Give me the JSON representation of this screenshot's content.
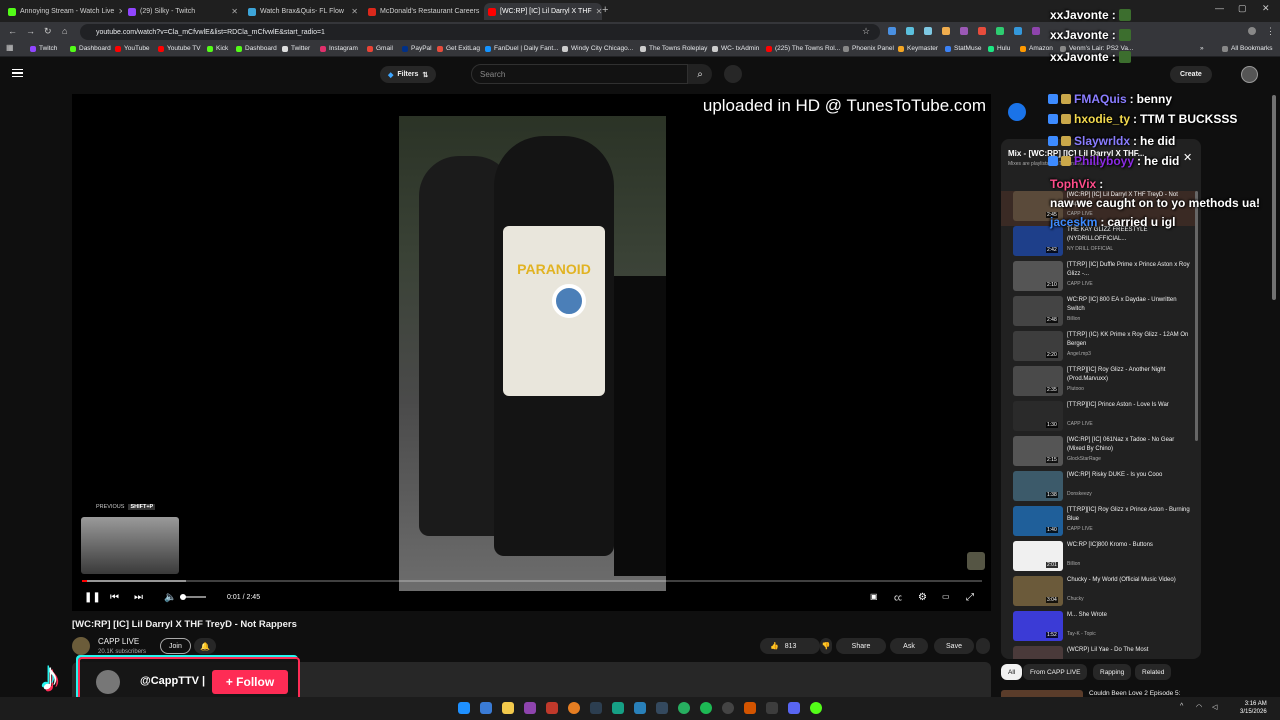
{
  "browser": {
    "tabs": [
      {
        "label": "Annoying Stream - Watch Live",
        "color": "#53fc18"
      },
      {
        "label": "(29) Silky - Twitch",
        "color": "#9146ff"
      },
      {
        "label": "Watch Brax&Quis- FL Flow",
        "color": "#3da5d9"
      },
      {
        "label": "McDonald's Restaurant Careers",
        "color": "#da291c"
      },
      {
        "label": "[WC:RP] [IC] Lil Darryl X THF",
        "color": "#ff0000"
      }
    ],
    "url": "youtube.com/watch?v=Cla_mCfvwlE&list=RDCla_mCfvwlE&start_radio=1",
    "bookmarks": [
      "Twitch",
      "Dashboard",
      "YouTube",
      "Youtube TV",
      "Kick",
      "Dashboard",
      "Twitter",
      "Instagram",
      "Gmail",
      "PayPal",
      "Get ExitLag",
      "FanDuel | Daily Fant...",
      "Windy City Chicago...",
      "The Towns Roleplay",
      "WC- txAdmin",
      "(225) The Towns Rol...",
      "Phoenix Panel",
      "Keymaster",
      "StatMuse",
      "Hulu",
      "Amazon",
      "Venm's Lair: PS2 Va..."
    ],
    "all_bookmarks_label": "All Bookmarks"
  },
  "youtube": {
    "filters_label": "Filters",
    "search_placeholder": "Search",
    "create_label": "Create"
  },
  "player": {
    "watermark": "uploaded in HD @ TunesToTube.com",
    "shirt_text": "PARANOID",
    "prev_label": "PREVIOUS",
    "prev_shortcut": "SHIFT+P",
    "time_current": "0:01",
    "time_separator": " / ",
    "time_total": "2:45",
    "progress_played": 0.006,
    "progress_buffered": 0.115
  },
  "video": {
    "title": "[WC:RP] [IC] Lil Darryl X THF TreyD - Not Rappers",
    "channel": "CAPP LIVE",
    "subscribers": "20.1K subscribers",
    "join_label": "Join",
    "likes": "813",
    "share_label": "Share",
    "ask_label": "Ask",
    "save_label": "Save"
  },
  "tiktok": {
    "handle": "@CappTTV |",
    "follow_label": "+ Follow"
  },
  "playlist": {
    "title": "Mix - [WC:RP] [IC] Lil Darryl X THF...",
    "subtitle": "Mixes are playlists YouTube makes for you",
    "items": [
      {
        "title": "[WC:RP] [IC] Lil Darryl X THF TreyD - Not Rappers",
        "channel": "CAPP LIVE",
        "duration": "2:45"
      },
      {
        "title": "THE KAY GLIZZ FREESTYLE (NYDRILLOFFICIAL...",
        "channel": "NY DRILL OFFICIAL",
        "duration": "2:42"
      },
      {
        "title": "[TT:RP] [IC] Duffle Prime x Prince Aston x Roy Glizz -...",
        "channel": "CAPP LIVE",
        "duration": "2:10"
      },
      {
        "title": "WC:RP [IC] 800 EA x Daydae - Unwritten Switch",
        "channel": "Billion",
        "duration": "2:48"
      },
      {
        "title": "[TT:RP] (IC) KK Prime x Roy Glizz - 12AM On Bergen",
        "channel": "Angel.mp3",
        "duration": "2:20"
      },
      {
        "title": "[TT:RP][IC] Roy Glizz - Another Night (Prod.Marvuxx)",
        "channel": "Plutooo",
        "duration": "2:35"
      },
      {
        "title": "[TT:RP][IC] Prince Aston - Love Is War",
        "channel": "CAPP LIVE",
        "duration": "1:30"
      },
      {
        "title": "[WC:RP] [IC] 061Naz x Tadoe - No Gear (Mixed By Chino)",
        "channel": "GlockStarRage",
        "duration": "2:15"
      },
      {
        "title": "[WC:RP] Risky DUKE - Is you Cooo",
        "channel": "Donskeezy",
        "duration": "1:38"
      },
      {
        "title": "[TT:RP][IC] Roy Glizz x Prince Aston - Burning Blue",
        "channel": "CAPP LIVE",
        "duration": "1:40"
      },
      {
        "title": "WC:RP [IC]800 Kromo - Buttons",
        "channel": "Billion",
        "duration": "2:01"
      },
      {
        "title": "Chucky - My World (Official Music Video)",
        "channel": "Chucky",
        "duration": "3:04"
      },
      {
        "title": "M... She Wrote",
        "channel": "Tay-K - Topic",
        "duration": "1:52"
      },
      {
        "title": "(WCRP) Lil Yae - Do The Most",
        "channel": "",
        "duration": ""
      }
    ],
    "chips": [
      "All",
      "From CAPP LIVE",
      "Rapping",
      "Related"
    ],
    "next_title": "Couldn Been Love 2 Episode 5:"
  },
  "chat": [
    {
      "user": "xxJavonte",
      "text": "",
      "color": "#ffffff",
      "badges": 0,
      "emote": true
    },
    {
      "user": "xxJavonte",
      "text": "",
      "color": "#ffffff",
      "badges": 0,
      "emote": true
    },
    {
      "user": "xxJavonte",
      "text": "",
      "color": "#ffffff",
      "badges": 0,
      "emote": true
    },
    {
      "user": "FMAQuis",
      "text": "benny",
      "color": "#8a7dff",
      "badges": 2,
      "emote": false
    },
    {
      "user": "hxodie_ty",
      "text": "TTM T BUCKSSS",
      "color": "#f2d94e",
      "badges": 2,
      "emote": false
    },
    {
      "user": "Slaywrldx",
      "text": "he did",
      "color": "#8a7dff",
      "badges": 2,
      "emote": false
    },
    {
      "user": "Phillyboyy",
      "text": "he did",
      "color": "#8a2be2",
      "badges": 2,
      "emote": false
    },
    {
      "user": "TophVix",
      "text": "naw we caught on to yo methods ua!",
      "color": "#ff4d8b",
      "badges": 0,
      "emote": false
    },
    {
      "user": "jaceskm",
      "text": "carried u igl",
      "color": "#3d8bff",
      "badges": 0,
      "emote": false
    }
  ],
  "taskbar": {
    "time": "3:16 AM",
    "date": "3/15/2026"
  }
}
